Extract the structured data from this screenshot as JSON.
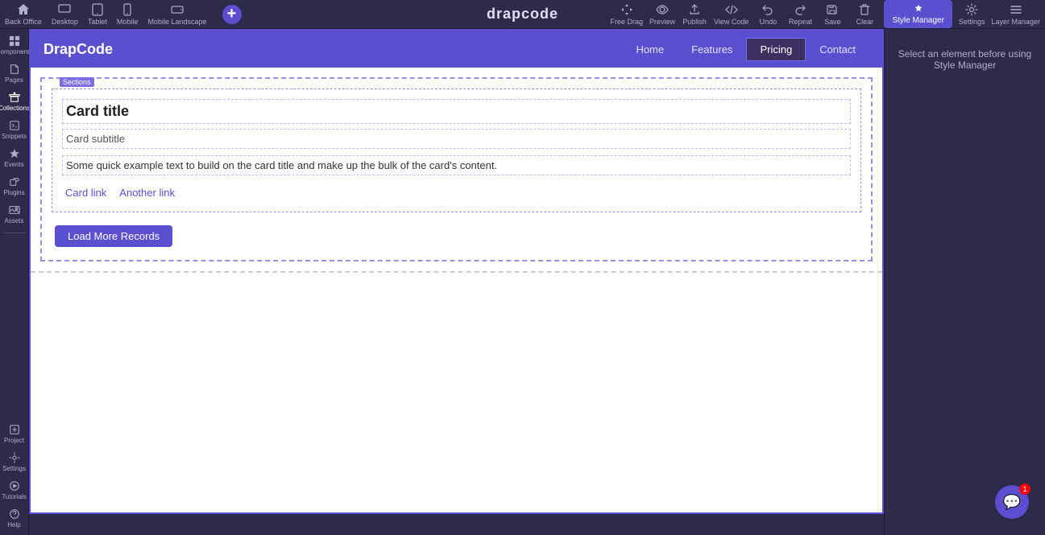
{
  "app": {
    "title": "drapcode"
  },
  "toolbar": {
    "items_left": [
      {
        "id": "back-office",
        "label": "Back Office",
        "icon": "home"
      },
      {
        "id": "desktop",
        "label": "Desktop",
        "icon": "monitor"
      },
      {
        "id": "tablet",
        "label": "Tablet",
        "icon": "tablet"
      },
      {
        "id": "mobile",
        "label": "Mobile",
        "icon": "mobile"
      },
      {
        "id": "landscape",
        "label": "Mobile Landscape",
        "icon": "landscape"
      }
    ],
    "items_right": [
      {
        "id": "free-drag",
        "label": "Free Drag",
        "icon": "drag"
      },
      {
        "id": "preview",
        "label": "Preview",
        "icon": "eye"
      },
      {
        "id": "publish",
        "label": "Publish",
        "icon": "upload"
      },
      {
        "id": "view-code",
        "label": "View Code",
        "icon": "code"
      },
      {
        "id": "undo",
        "label": "Undo",
        "icon": "undo"
      },
      {
        "id": "repeat",
        "label": "Repeat",
        "icon": "redo"
      },
      {
        "id": "save",
        "label": "Save",
        "icon": "save"
      },
      {
        "id": "clear",
        "label": "Clear",
        "icon": "trash"
      }
    ],
    "style_manager": "Style Manager",
    "settings": "Settings",
    "layer_manager": "Layer Manager"
  },
  "sidebar": {
    "items": [
      {
        "id": "components",
        "label": "Components",
        "icon": "grid"
      },
      {
        "id": "pages",
        "label": "Pages",
        "icon": "file"
      },
      {
        "id": "collections",
        "label": "Collections",
        "icon": "collection",
        "active": true
      },
      {
        "id": "snippets",
        "label": "Snippets",
        "icon": "snippet"
      },
      {
        "id": "events",
        "label": "Events",
        "icon": "events"
      },
      {
        "id": "plugins",
        "label": "Plugins",
        "icon": "plugin"
      },
      {
        "id": "assets",
        "label": "Assets",
        "icon": "image"
      }
    ],
    "bottom_items": [
      {
        "id": "project",
        "label": "Project",
        "icon": "project"
      },
      {
        "id": "settings",
        "label": "Settings",
        "icon": "gear"
      },
      {
        "id": "tutorials",
        "label": "Tutorials",
        "icon": "play"
      },
      {
        "id": "help",
        "label": "Help",
        "icon": "help"
      }
    ]
  },
  "preview": {
    "sections_label": "Sections",
    "navbar": {
      "brand": "DrapCode",
      "links": [
        {
          "id": "home",
          "label": "Home",
          "active": false
        },
        {
          "id": "features",
          "label": "Features",
          "active": false
        },
        {
          "id": "pricing",
          "label": "Pricing",
          "active": true
        },
        {
          "id": "contact",
          "label": "Contact",
          "active": false
        }
      ]
    },
    "card": {
      "title": "Card title",
      "subtitle": "Card subtitle",
      "text": "Some quick example text to build on the card title and make up the bulk of the card's content.",
      "link1": "Card link",
      "link2": "Another link"
    },
    "load_more_btn": "Load More Records"
  },
  "right_panel": {
    "message": "Select an element before using Style Manager"
  },
  "chat": {
    "badge": "1"
  }
}
